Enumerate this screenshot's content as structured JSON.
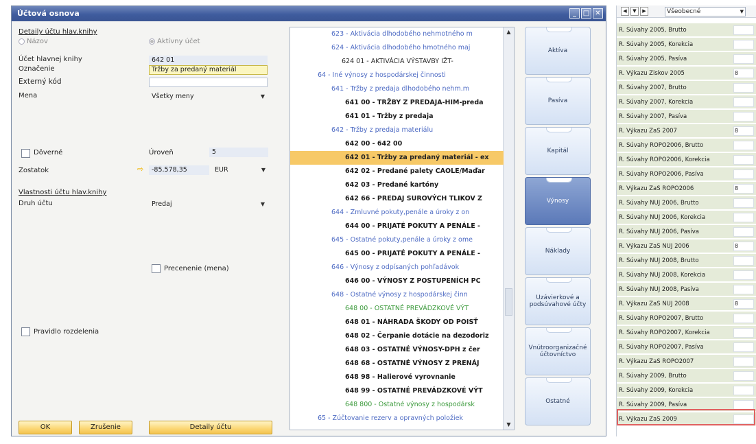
{
  "window": {
    "title": "Účtová osnova"
  },
  "form": {
    "section_details": "Detaily účtu hlav.knihy",
    "radio_title": "Názov",
    "radio_active": "Aktívny účet",
    "account_label": "Účet hlavnej knihy",
    "account_value": "642 01",
    "designation_label": "Označenie",
    "designation_value": "Tržby za predaný materiál",
    "external_code_label": "Externý kód",
    "external_code_value": "",
    "currency_label": "Mena",
    "currency_value": "Všetky meny",
    "confidential_label": "Dôverné",
    "level_label": "Úroveň",
    "level_value": "5",
    "balance_label": "Zostatok",
    "balance_value": "-85.578,35",
    "balance_currency": "EUR",
    "properties_label": "Vlastnosti účtu hlav.knihy",
    "account_type_label": "Druh účtu",
    "account_type_value": "Predaj",
    "revaluation_label": "Precenenie (mena)",
    "distribution_label": "Pravidlo rozdelenia",
    "ok_button": "OK",
    "cancel_button": "Zrušenie",
    "details_button": "Detaily účtu"
  },
  "tree": {
    "rows": [
      {
        "text": "623 - Aktivácia dlhodobého nehmotného m",
        "style": "c-blue",
        "indent": 60
      },
      {
        "text": "624 - Aktivácia dlhodobého hmotného maj",
        "style": "c-blue",
        "indent": 60
      },
      {
        "text": "624 01 - AKTIVÁCIA VÝSTAVBY  IŽT-",
        "style": "c-dark",
        "indent": 75
      },
      {
        "text": "64 - Iné výnosy z hospodárskej činnosti",
        "style": "c-blue",
        "indent": 40
      },
      {
        "text": "641 - Tržby z predaja dlhodobého nehm.m",
        "style": "c-blue",
        "indent": 60
      },
      {
        "text": "641 00 - TRŽBY Z PREDAJA-HIM-preda",
        "style": "c-black",
        "indent": 80
      },
      {
        "text": "641 01 - Tržby z predaja",
        "style": "c-black",
        "indent": 80
      },
      {
        "text": "642 - Tržby z predaja materiálu",
        "style": "c-blue",
        "indent": 60
      },
      {
        "text": "642 00 - 642 00",
        "style": "c-black",
        "indent": 80
      },
      {
        "text": "642 01 - Tržby za predaný materiál - ex",
        "style": "sel",
        "indent": 80
      },
      {
        "text": "642 02 - Predané palety CAOLE/Maďar",
        "style": "c-black",
        "indent": 80
      },
      {
        "text": "642 03 - Predané kartóny",
        "style": "c-black",
        "indent": 80
      },
      {
        "text": "642 66 - PREDAJ SUROVÝCH TLIKOV Z",
        "style": "c-black",
        "indent": 80
      },
      {
        "text": "644 - Zmluvné pokuty,penále a úroky z on",
        "style": "c-blue",
        "indent": 60
      },
      {
        "text": "644 00 - PRIJATÉ POKUTY A PENÁLE -",
        "style": "c-black",
        "indent": 80
      },
      {
        "text": "645 - Ostatné pokuty,penále a úroky z ome",
        "style": "c-blue",
        "indent": 60
      },
      {
        "text": "645 00 - PRIJATÉ POKUTY A PENÁLE -",
        "style": "c-black",
        "indent": 80
      },
      {
        "text": "646 - Výnosy z odpísaných pohľadávok",
        "style": "c-blue",
        "indent": 60
      },
      {
        "text": "646 00 - VÝNOSY Z POSTUPENÍCH PC",
        "style": "c-black",
        "indent": 80
      },
      {
        "text": "648 - Ostatné výnosy z hospodárskej činn",
        "style": "c-blue",
        "indent": 60
      },
      {
        "text": "648 00 - OSTATNÉ PREVÁDZKOVÉ VÝT",
        "style": "c-green",
        "indent": 80
      },
      {
        "text": "648 01 - NÁHRADA ŠKODY OD POISŤ",
        "style": "c-black",
        "indent": 80
      },
      {
        "text": "648 02 - Čerpanie dotácie na dezodoriz",
        "style": "c-black",
        "indent": 80
      },
      {
        "text": "648 03 - OSTATNÉ VÝNOSY-DPH z čer",
        "style": "c-black",
        "indent": 80
      },
      {
        "text": "648 68 - OSTATNÉ VÝNOSY Z PRENÁJ",
        "style": "c-black",
        "indent": 80
      },
      {
        "text": "648 98 - Halierové vyrovnanie",
        "style": "c-black",
        "indent": 80
      },
      {
        "text": "648 99 - OSTATNÉ PREVÁDZKOVÉ VÝT",
        "style": "c-black",
        "indent": 80
      },
      {
        "text": "648 800 - Ostatné výnosy z hospodársk",
        "style": "c-green",
        "indent": 80
      },
      {
        "text": "65 - Zúčtovanie rezerv a opravných položiek",
        "style": "c-blue",
        "indent": 40
      }
    ]
  },
  "categories": [
    {
      "label": "Aktíva",
      "active": false
    },
    {
      "label": "Pasíva",
      "active": false
    },
    {
      "label": "Kapitál",
      "active": false
    },
    {
      "label": "Výnosy",
      "active": true
    },
    {
      "label": "Náklady",
      "active": false
    },
    {
      "label": "Uzávierkové a podsúvahové účty",
      "active": false
    },
    {
      "label": "Vnútroorganizačné účtovníctvo",
      "active": false
    },
    {
      "label": "Ostatné",
      "active": false
    }
  ],
  "right_panel": {
    "dropdown": "Všeobecné",
    "rows": [
      {
        "label": "R. Súvahy 2005, Brutto",
        "val": ""
      },
      {
        "label": "R. Súvahy 2005, Korekcia",
        "val": ""
      },
      {
        "label": "R. Súvahy 2005, Pasíva",
        "val": ""
      },
      {
        "label": "R. Výkazu Ziskov 2005",
        "val": "8"
      },
      {
        "label": "R. Súvahy 2007, Brutto",
        "val": ""
      },
      {
        "label": "R. Súvahy 2007, Korekcia",
        "val": ""
      },
      {
        "label": "R. Súvahy 2007, Pasíva",
        "val": ""
      },
      {
        "label": "R. Výkazu ZaS 2007",
        "val": "8"
      },
      {
        "label": "R. Súvahy ROPO2006, Brutto",
        "val": ""
      },
      {
        "label": "R. Súvahy ROPO2006, Korekcia",
        "val": ""
      },
      {
        "label": "R. Súvahy ROPO2006, Pasíva",
        "val": ""
      },
      {
        "label": "R. Výkazu ZaS ROPO2006",
        "val": "8"
      },
      {
        "label": "R. Súvahy NUJ 2006, Brutto",
        "val": ""
      },
      {
        "label": "R. Súvahy NUJ 2006, Korekcia",
        "val": ""
      },
      {
        "label": "R. Súvahy NUJ 2006, Pasíva",
        "val": ""
      },
      {
        "label": "R. Výkazu ZaS NUJ 2006",
        "val": "8"
      },
      {
        "label": "R. Súvahy NUJ 2008, Brutto",
        "val": ""
      },
      {
        "label": "R. Súvahy NUJ 2008, Korekcia",
        "val": ""
      },
      {
        "label": "R. Súvahy NUJ 2008, Pasíva",
        "val": ""
      },
      {
        "label": "R. Výkazu ZaS NUJ 2008",
        "val": "8"
      },
      {
        "label": "R. Súvahy ROPO2007, Brutto",
        "val": ""
      },
      {
        "label": "R. Súvahy ROPO2007, Korekcia",
        "val": ""
      },
      {
        "label": "R. Súvahy ROPO2007, Pasíva",
        "val": ""
      },
      {
        "label": "R. Výkazu ZaS ROPO2007",
        "val": ""
      },
      {
        "label": "R. Súvahy 2009, Brutto",
        "val": ""
      },
      {
        "label": "R. Súvahy 2009, Korekcia",
        "val": ""
      },
      {
        "label": "R. Súvahy 2009, Pasíva",
        "val": ""
      },
      {
        "label": "R. Výkazu ZaS 2009",
        "val": ""
      }
    ]
  }
}
